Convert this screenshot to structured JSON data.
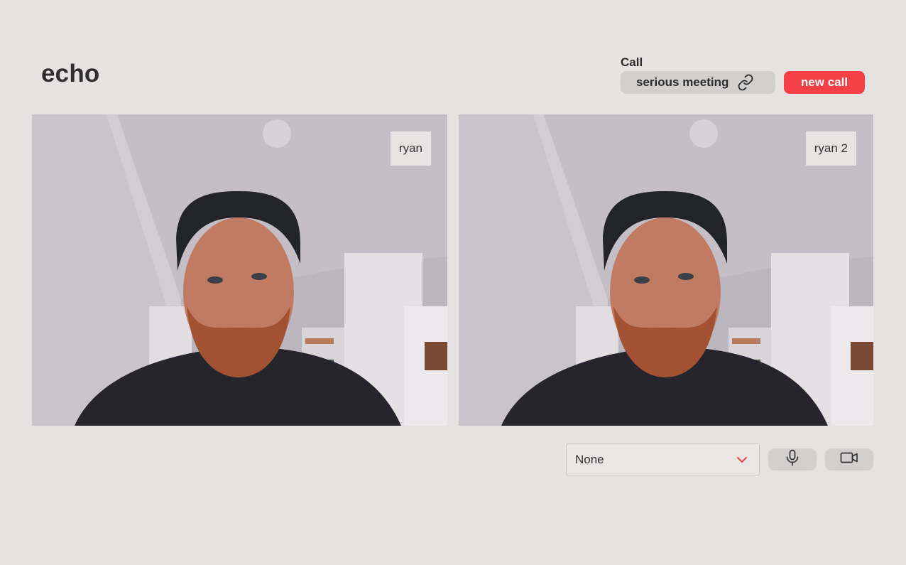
{
  "app": {
    "title": "echo"
  },
  "call": {
    "label": "Call",
    "meeting_name": "serious meeting",
    "new_call_label": "new call",
    "accent": "#f43f46"
  },
  "participants": [
    {
      "name": "ryan"
    },
    {
      "name": "ryan 2"
    }
  ],
  "controls": {
    "device_select": {
      "value": "None"
    },
    "mic_icon": "microphone-icon",
    "camera_icon": "video-camera-icon"
  }
}
